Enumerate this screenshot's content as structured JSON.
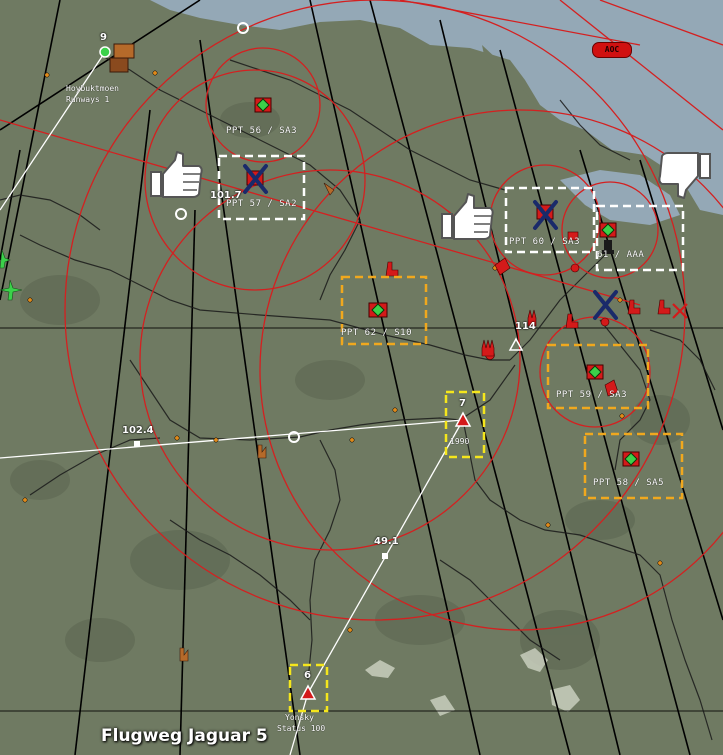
{
  "map_title": "Flugweg Jaguar 5",
  "airbase": {
    "name": "Hoybuktmoen",
    "sub": "Runways 1",
    "waypoint_number": "9"
  },
  "end_point": {
    "name": "Yonsky",
    "sub": "Status 100",
    "waypoint_number": "6"
  },
  "waypoints": [
    {
      "number": "7",
      "value": "1990"
    },
    {
      "number": "114"
    }
  ],
  "leg_distances": [
    "102.4",
    "49.1",
    "101.7"
  ],
  "targets": [
    {
      "label": "PPT 56 / SA3",
      "status": "none"
    },
    {
      "label": "PPT 57 / SA2",
      "status": "destroyed"
    },
    {
      "label": "PPT 60 / SA3",
      "status": "destroyed"
    },
    {
      "label": "61 / AAA",
      "status": "pending"
    },
    {
      "label": "PPT 62 / S10",
      "status": "planned"
    },
    {
      "label": "PPT 59 / SA3",
      "status": "planned"
    },
    {
      "label": "PPT 58 / SA5",
      "status": "planned"
    }
  ],
  "aoc_badge": "AOC",
  "icons": [
    "thumbs-up-icon",
    "thumbs-down-icon",
    "destroyed-x-icon",
    "sam-site-icon",
    "aircraft-icon",
    "radar-icon",
    "factory-icon",
    "waypoint-triangle-icon"
  ],
  "colors": {
    "terrain": "#6f7a62",
    "terrain_dark": "#5f6a54",
    "water": "#94a8b6",
    "threat_ring": "#d42020",
    "route": "#ffffff",
    "planned_box": "#f0a81e",
    "waypoint_box": "#f5e61c",
    "destroyed_box": "#ffffff",
    "destroyed_x": "#1a2a6a",
    "sam_red": "#d41a1a",
    "sam_green": "#3bd14a"
  }
}
